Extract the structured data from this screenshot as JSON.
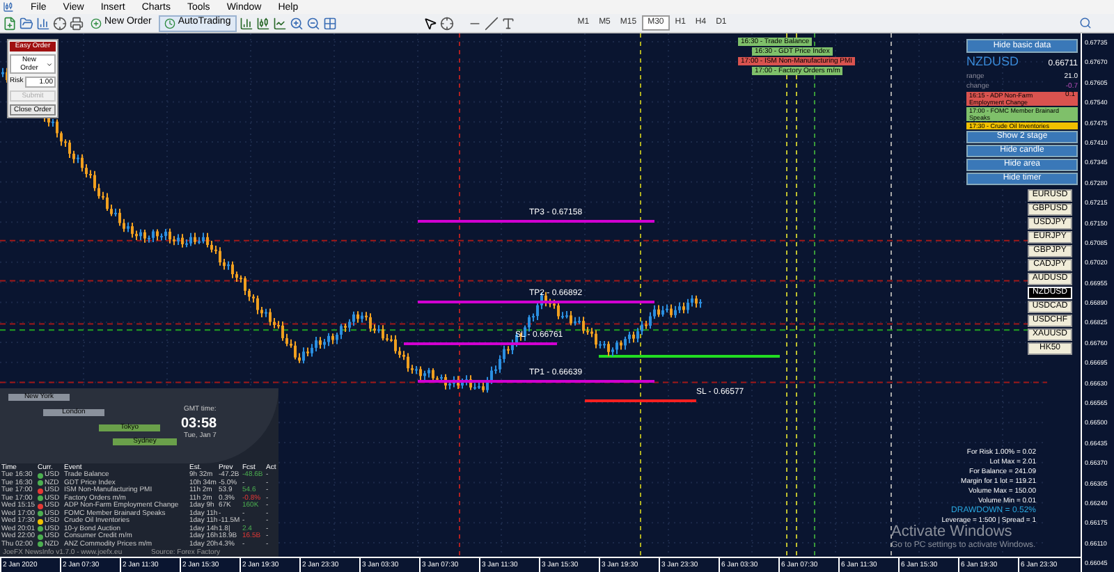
{
  "menu": [
    "File",
    "View",
    "Insert",
    "Charts",
    "Tools",
    "Window",
    "Help"
  ],
  "toolbar": {
    "new_order": "New Order",
    "auto_trading": "AutoTrading",
    "timeframes": [
      {
        "label": "M1",
        "selected": false
      },
      {
        "label": "M5",
        "selected": false
      },
      {
        "label": "M15",
        "selected": false
      },
      {
        "label": "M30",
        "selected": true
      },
      {
        "label": "H1",
        "selected": false
      },
      {
        "label": "H4",
        "selected": false
      },
      {
        "label": "D1",
        "selected": false
      }
    ]
  },
  "easy_order": {
    "title": "Easy Order",
    "order_type": "New Order",
    "risk_label": "Risk",
    "risk_value": "1.00",
    "submit": {
      "label": "Submit",
      "disabled": true
    },
    "close": "Close Order"
  },
  "news_tags": [
    {
      "text": "16:30 - Trade Balance",
      "color": "#7fc06a"
    },
    {
      "text": "16:30 - GDT Price Index",
      "color": "#7fc06a"
    },
    {
      "text": "17:00 - ISM Non-Manufacturing PMI",
      "color": "#d9534f"
    },
    {
      "text": "17:00 - Factory Orders m/m",
      "color": "#7fc06a"
    }
  ],
  "levels": [
    {
      "label": "TP3 - 0.67158",
      "color": "#d100d1"
    },
    {
      "label": "TP2 - 0.66892",
      "color": "#d100d1"
    },
    {
      "label": "SL - 0.66761",
      "color": "#d100d1"
    },
    {
      "label": "TP1 - 0.66639",
      "color": "#d100d1"
    },
    {
      "label": "SL - 0.66577",
      "color": "#ff2020"
    }
  ],
  "info_panel": {
    "hide_basic": "Hide basic data",
    "symbol": "NZDUSD",
    "price": "0.66711",
    "rows": [
      {
        "label": "range",
        "value": "21.0",
        "kind": "plain"
      },
      {
        "label": "change",
        "value": "-0.7",
        "kind": "negative"
      }
    ],
    "news": [
      {
        "text": "16:15 - ADP Non-Farm Employment Change",
        "value": "0.1",
        "color": "#d9534f"
      },
      {
        "text": "17:00 - FOMC Member Brainard Speaks",
        "color": "#7fc06a"
      },
      {
        "text": "17:30 - Crude Oil Inventories",
        "color": "#f0c000"
      }
    ],
    "buttons": [
      "Show 2 stage",
      "Hide candle",
      "Hide area",
      "Hide timer"
    ]
  },
  "symbols": [
    {
      "label": "EURUSD",
      "selected": false
    },
    {
      "label": "GBPUSD",
      "selected": false
    },
    {
      "label": "USDJPY",
      "selected": false
    },
    {
      "label": "EURJPY",
      "selected": false
    },
    {
      "label": "GBPJPY",
      "selected": false
    },
    {
      "label": "CADJPY",
      "selected": false
    },
    {
      "label": "AUDUSD",
      "selected": false
    },
    {
      "label": "NZDUSD",
      "selected": true
    },
    {
      "label": "USDCAD",
      "selected": false
    },
    {
      "label": "USDCHF",
      "selected": false
    },
    {
      "label": "XAUUSD",
      "selected": false
    },
    {
      "label": "HK50",
      "selected": false
    }
  ],
  "clock": {
    "sessions": [
      "New York",
      "London",
      "Tokyo",
      "Sydney"
    ],
    "gmt_label": "GMT time:",
    "time": "03:58",
    "date": "Tue, Jan 7"
  },
  "news_table": {
    "columns": [
      "Time",
      "Curr.",
      "Event",
      "Est.",
      "Prev",
      "Fcst",
      "Act"
    ],
    "rows": [
      {
        "time": "Tue 16:30",
        "currency": "USD",
        "color": "#4caf50",
        "event": "Trade Balance",
        "est": "9h 32m",
        "prev": "-47.2B",
        "fcst": {
          "text": "-48.6B",
          "kind": "better"
        },
        "act": "-"
      },
      {
        "time": "Tue 16:30",
        "currency": "NZD",
        "color": "#4caf50",
        "event": "GDT Price Index",
        "est": "10h 34m",
        "prev": "-5.0%",
        "fcst": {
          "text": "-",
          "kind": "neutral"
        },
        "act": "-"
      },
      {
        "time": "Tue 17:00",
        "currency": "USD",
        "color": "#e53935",
        "event": "ISM Non-Manufacturing PMI",
        "est": "11h 2m",
        "prev": "53.9",
        "fcst": {
          "text": "54.6",
          "kind": "better"
        },
        "act": "-"
      },
      {
        "time": "Tue 17:00",
        "currency": "USD",
        "color": "#4caf50",
        "event": "Factory Orders m/m",
        "est": "11h 2m",
        "prev": "0.3%",
        "fcst": {
          "text": "-0.8%",
          "kind": "worse"
        },
        "act": "-"
      },
      {
        "time": "Wed 15:15",
        "currency": "USD",
        "color": "#e53935",
        "event": "ADP Non-Farm Employment Change",
        "est": "1day 9h",
        "prev": "67K",
        "fcst": {
          "text": "160K",
          "kind": "better"
        },
        "act": "-"
      },
      {
        "time": "Wed 17:00",
        "currency": "USD",
        "color": "#4caf50",
        "event": "FOMC Member Brainard Speaks",
        "est": "1day 11h",
        "prev": "-",
        "fcst": {
          "text": "-",
          "kind": "neutral"
        },
        "act": "-"
      },
      {
        "time": "Wed 17:30",
        "currency": "USD",
        "color": "#f0c000",
        "event": "Crude Oil Inventories",
        "est": "1day 11h",
        "prev": "-11.5M",
        "fcst": {
          "text": "-",
          "kind": "neutral"
        },
        "act": "-"
      },
      {
        "time": "Wed 20:01",
        "currency": "USD",
        "color": "#4caf50",
        "event": "10-y Bond Auction",
        "est": "1day 14h",
        "prev": "1.8|",
        "fcst": {
          "text": "2.4",
          "kind": "better"
        },
        "act": "-"
      },
      {
        "time": "Wed 22:00",
        "currency": "USD",
        "color": "#4caf50",
        "event": "Consumer Credit m/m",
        "est": "1day 16h",
        "prev": "18.9B",
        "fcst": {
          "text": "16.5B",
          "kind": "worse"
        },
        "act": "-"
      },
      {
        "time": "Thu 02:00",
        "currency": "NZD",
        "color": "#4caf50",
        "event": "ANZ Commodity Prices m/m",
        "est": "1day 20h",
        "prev": "4.3%",
        "fcst": {
          "text": "-",
          "kind": "neutral"
        },
        "act": "-"
      }
    ],
    "footer_left": "JoeFX NewsInfo v1.7.0 - www.joefx.eu",
    "footer_right": "Source: Forex Factory"
  },
  "risk_stats": [
    {
      "text": "For Risk 1.00% = 0.02",
      "kind": "plain"
    },
    {
      "text": "Lot Max = 2.01",
      "kind": "plain"
    },
    {
      "text": "For Balance = 241.09",
      "kind": "plain"
    },
    {
      "text": "Margin for 1 lot = 119.21",
      "kind": "plain"
    },
    {
      "text": "Volume Max = 150.00",
      "kind": "plain"
    },
    {
      "text": "Volume Min = 0.01",
      "kind": "plain"
    },
    {
      "text": "DRAWDOWN = 0.52%",
      "kind": "highlight"
    },
    {
      "text": "Leverage = 1:500 | Spread = 1",
      "kind": "plain"
    }
  ],
  "price_axis": [
    "0.67735",
    "0.67670",
    "0.67605",
    "0.67540",
    "0.67475",
    "0.67410",
    "0.67345",
    "0.67280",
    "0.67215",
    "0.67150",
    "0.67085",
    "0.67020",
    "0.66955",
    "0.66890",
    "0.66825",
    "0.66760",
    "0.66695",
    "0.66630",
    "0.66565",
    "0.66500",
    "0.66435",
    "0.66370",
    "0.66305",
    "0.66240",
    "0.66175",
    "0.66110",
    "0.66045"
  ],
  "time_axis": [
    "2 Jan 2020",
    "2 Jan 07:30",
    "2 Jan 11:30",
    "2 Jan 15:30",
    "2 Jan 19:30",
    "2 Jan 23:30",
    "3 Jan 03:30",
    "3 Jan 07:30",
    "3 Jan 11:30",
    "3 Jan 15:30",
    "3 Jan 19:30",
    "3 Jan 23:30",
    "6 Jan 03:30",
    "6 Jan 07:30",
    "6 Jan 11:30",
    "6 Jan 15:30",
    "6 Jan 19:30",
    "6 Jan 23:30"
  ],
  "os_notice": {
    "title": "Activate Windows",
    "text": "Go to PC settings to activate Windows."
  }
}
